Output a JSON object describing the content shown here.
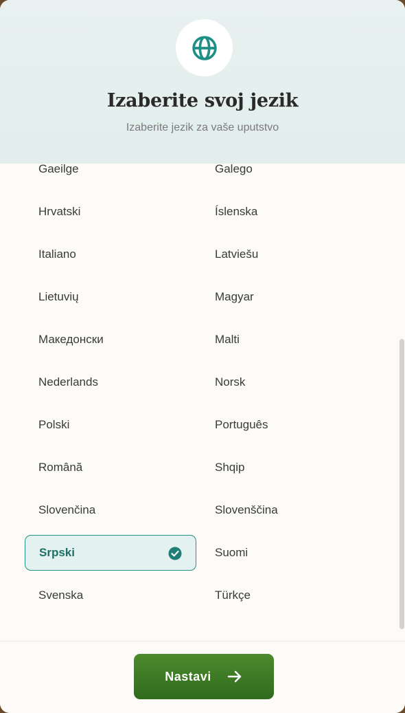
{
  "header": {
    "title": "Izaberite svoj jezik",
    "subtitle": "Izaberite jezik za vaše uputstvo",
    "icon": "globe-icon",
    "accent": "#1f8f86"
  },
  "languages": [
    {
      "label": "Gaeilge",
      "selected": false
    },
    {
      "label": "Galego",
      "selected": false
    },
    {
      "label": "Hrvatski",
      "selected": false
    },
    {
      "label": "Íslenska",
      "selected": false
    },
    {
      "label": "Italiano",
      "selected": false
    },
    {
      "label": "Latviešu",
      "selected": false
    },
    {
      "label": "Lietuvių",
      "selected": false
    },
    {
      "label": "Magyar",
      "selected": false
    },
    {
      "label": "Македонски",
      "selected": false
    },
    {
      "label": "Malti",
      "selected": false
    },
    {
      "label": "Nederlands",
      "selected": false
    },
    {
      "label": "Norsk",
      "selected": false
    },
    {
      "label": "Polski",
      "selected": false
    },
    {
      "label": "Português",
      "selected": false
    },
    {
      "label": "Română",
      "selected": false
    },
    {
      "label": "Shqip",
      "selected": false
    },
    {
      "label": "Slovenčina",
      "selected": false
    },
    {
      "label": "Slovenščina",
      "selected": false
    },
    {
      "label": "Srpski",
      "selected": true
    },
    {
      "label": "Suomi",
      "selected": false
    },
    {
      "label": "Svenska",
      "selected": false
    },
    {
      "label": "Türkçe",
      "selected": false
    }
  ],
  "footer": {
    "continue_label": "Nastavi",
    "continue_icon": "arrow-right-icon",
    "button_color": "#3d7a25"
  },
  "colors": {
    "selected_border": "#2a8f87",
    "selected_background": "#e3f1f0",
    "check_color": "#1f7e76"
  }
}
